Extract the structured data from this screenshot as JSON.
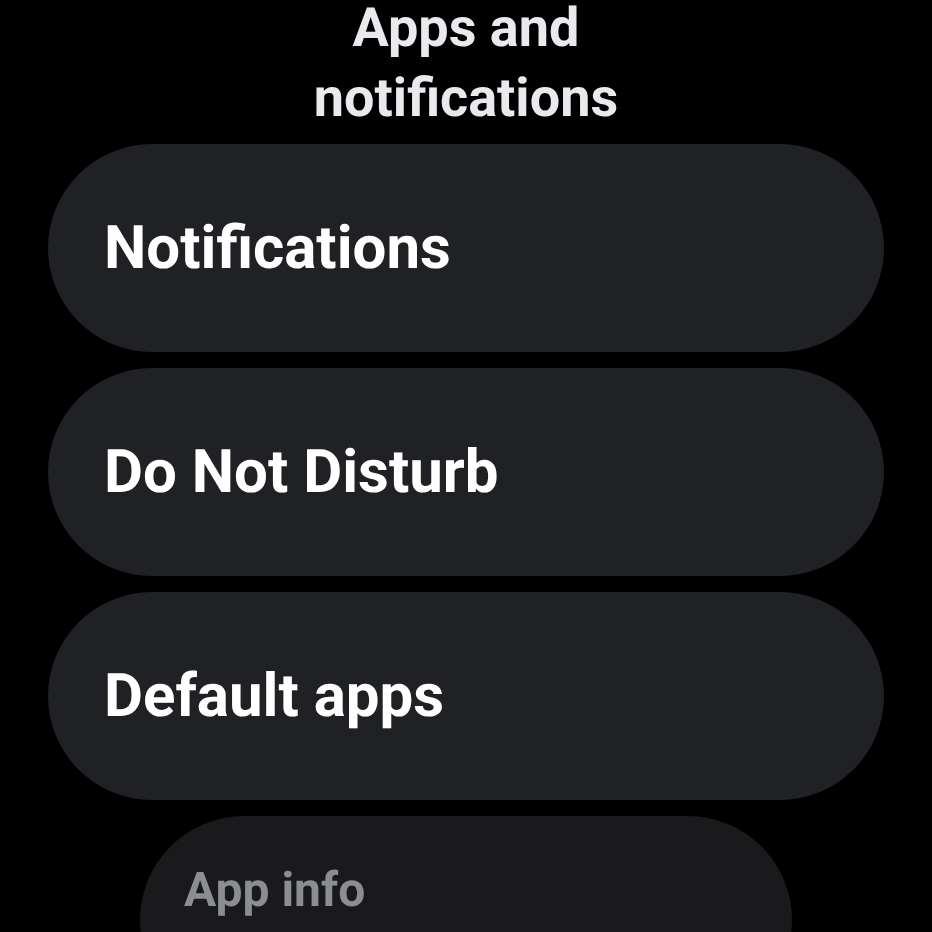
{
  "title": "Apps and notifications",
  "items": [
    {
      "label": "Notifications",
      "dimmed": false
    },
    {
      "label": "Do Not Disturb",
      "dimmed": false
    },
    {
      "label": "Default apps",
      "dimmed": false
    },
    {
      "label": "App info",
      "dimmed": true
    }
  ]
}
